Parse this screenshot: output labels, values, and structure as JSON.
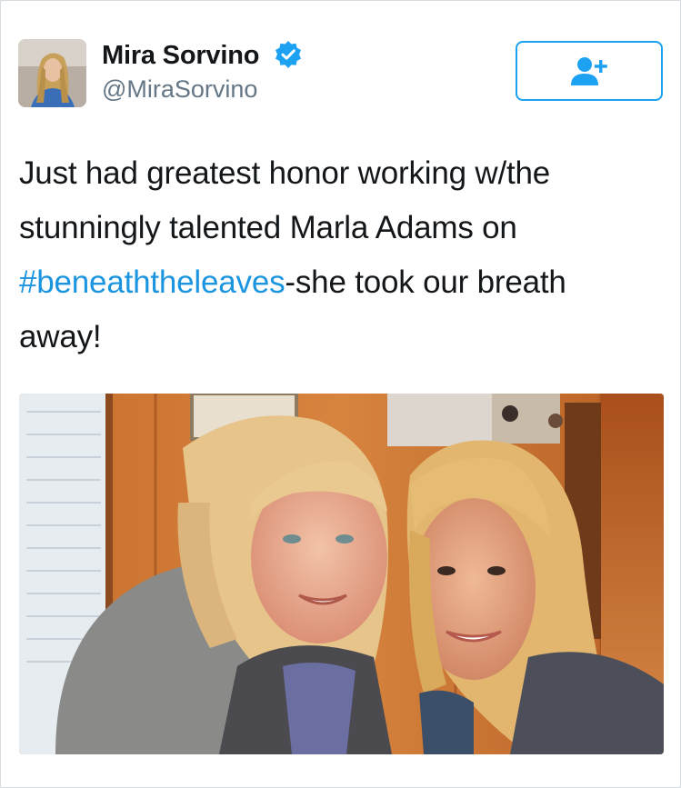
{
  "tweet": {
    "author": {
      "name": "Mira Sorvino",
      "handle": "@MiraSorvino",
      "verified_icon": "verified-badge-icon"
    },
    "follow_button": {
      "icon": "add-user-icon"
    },
    "text": {
      "line1": "Just had greatest honor working w/the",
      "line2": "stunningly talented Marla Adams on",
      "hashtag": "#beneaththeleaves",
      "after_hashtag": "-she took our breath",
      "line4": "away!"
    },
    "photo": {
      "icon": "photo-image"
    }
  },
  "colors": {
    "accent": "#1da1f2",
    "hashtag": "#1b95e0",
    "handle": "#657786",
    "text": "#14171a"
  }
}
